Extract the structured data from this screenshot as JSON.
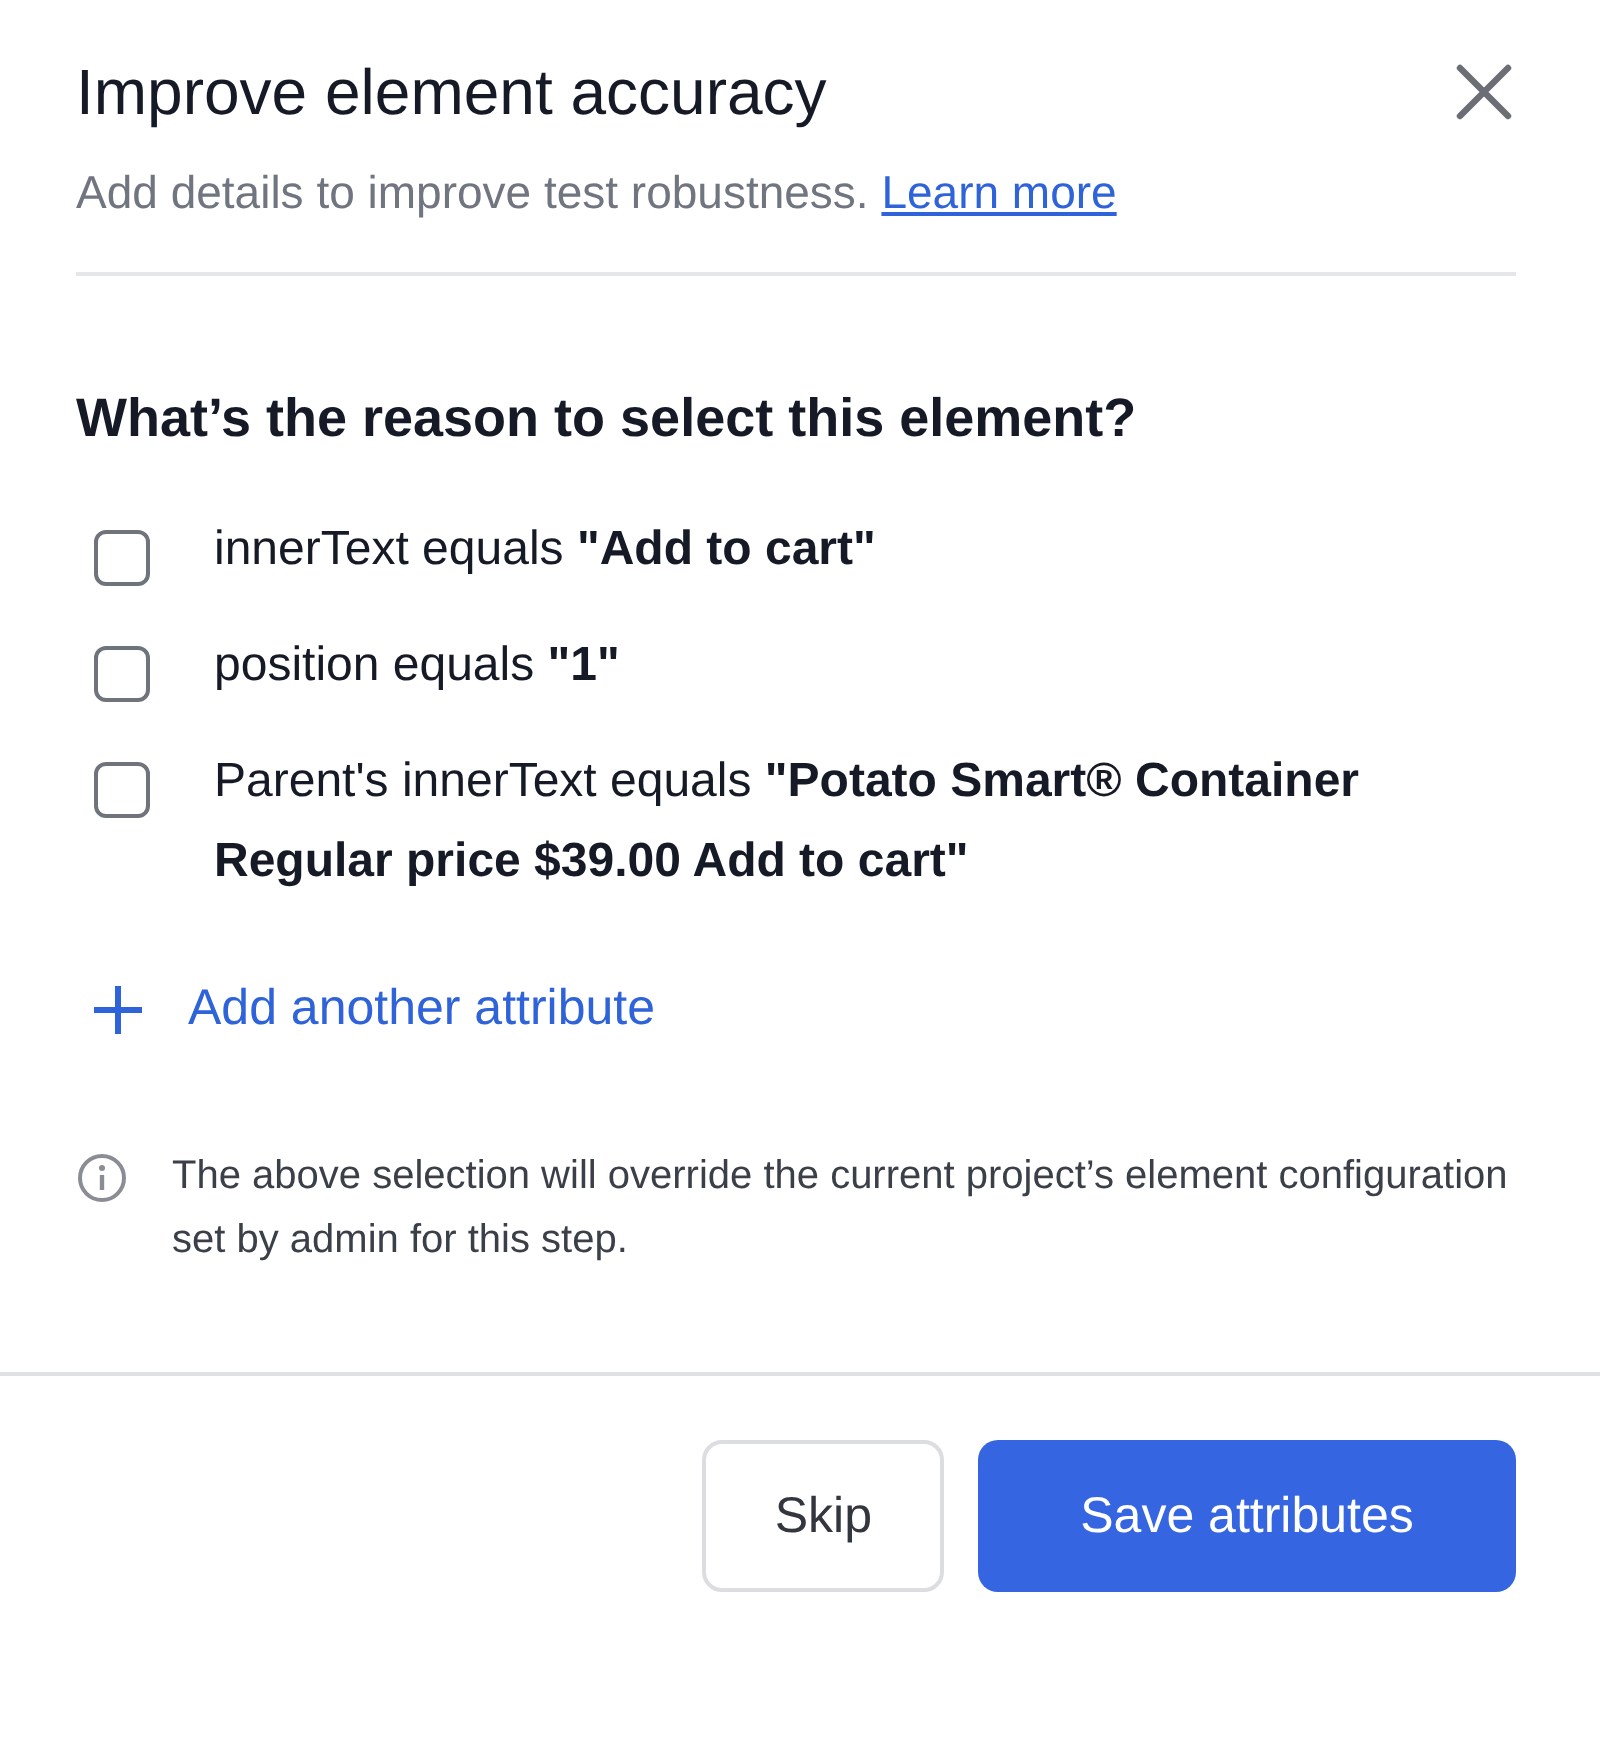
{
  "dialog": {
    "title": "Improve element accuracy",
    "subtitle": "Add details to improve test robustness.",
    "learn_more_link": "Learn more"
  },
  "question": "What’s the reason to select this element?",
  "options": [
    {
      "text": "innerText equals **\"Add to cart\"**",
      "checked": false
    },
    {
      "text": "position equals **\"1\"**",
      "checked": false
    },
    {
      "text": "Parent's innerText equals **\"Potato Smart® Container Regular price $39.00 Add to cart\"**",
      "checked": false
    }
  ],
  "add_attribute": "Add another attribute",
  "note": "The above selection will override the current project’s element configuration set by admin for this step.",
  "buttons": [
    {
      "label": "Skip",
      "kind": "secondary"
    },
    {
      "label": "Save attributes",
      "kind": "primary"
    }
  ]
}
